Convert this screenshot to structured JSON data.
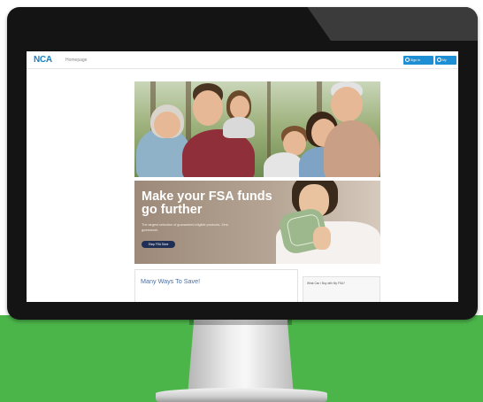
{
  "header": {
    "logo": "NCA",
    "breadcrumb": "Homepage",
    "sign_in_label": "Sign In",
    "account_label": "My Account"
  },
  "promo": {
    "headline": "Make your FSA funds go further",
    "subtext": "The largest selection of guaranteed-eligible products. Zero guesswork.",
    "cta_label": "Shop FSA Store"
  },
  "sections": {
    "main_title": "Many Ways To Save!",
    "side_title": "What Can I Buy with My FSA?"
  },
  "colors": {
    "accent": "#1e8fd4",
    "cta": "#1f2e55",
    "floor": "#4bb54a"
  }
}
